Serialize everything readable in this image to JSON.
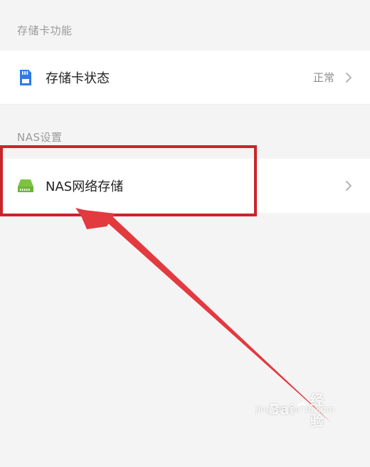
{
  "sections": [
    {
      "title": "存储卡功能",
      "items": [
        {
          "label": "存储卡状态",
          "status": "正常",
          "icon": "sd-card-icon",
          "icon_color": "#2f7ae5"
        }
      ]
    },
    {
      "title": "NAS设置",
      "items": [
        {
          "label": "NAS网络存储",
          "status": "",
          "icon": "nas-drive-icon",
          "icon_color": "#7dc242"
        }
      ]
    }
  ],
  "annotation": {
    "highlight_color": "#c8262b",
    "arrow_color": "#e23a3f"
  },
  "watermark": {
    "brand": "Bai",
    "brand_cn": "经验",
    "url": "jingyan.baidu.com"
  }
}
